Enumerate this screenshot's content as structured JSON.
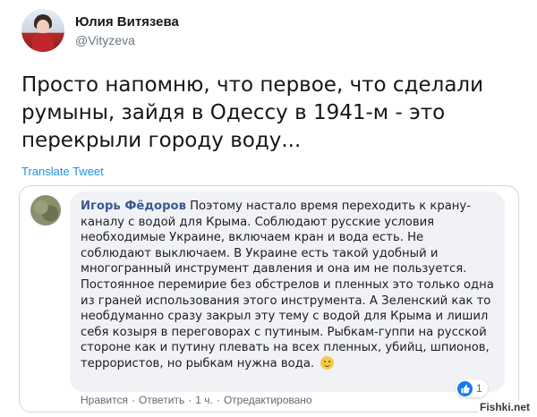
{
  "tweet": {
    "display_name": "Юлия Витязева",
    "handle": "@Vityzeva",
    "text": "Просто напомню, что первое, что сделали румыны, зайдя в Одессу в 1941-м - это перекрыли городу воду...",
    "translate_label": "Translate Tweet"
  },
  "embedded_comment": {
    "author": "Игорь Фёдоров",
    "text": "Поэтому настало время переходить к крану-каналу с водой для Крыма. Соблюдают русские условия необходимые Украине, включаем кран и вода есть. Не соблюдают выключаем. В Украине есть такой удобный и многогранный инструмент давления и она им не пользуется. Постоянное перемирие без обстрелов и пленных это только одна из граней использования этого инструмента. А Зеленский как то необдуманно сразу закрыл эту тему с водой для Крыма и лишил себя козыря в переговорах с путиным. Рыбкам-гуппи на русской стороне как и путину плевать на всех пленных, убийц, шпионов, террористов, но рыбкам нужна вода.",
    "reaction_count": "1",
    "actions": {
      "like": "Нравится",
      "reply": "Ответить",
      "time": "1 ч.",
      "edited": "Отредактировано",
      "separator": "·"
    }
  },
  "watermark": "Fishki.net",
  "icons": [
    "avatar-photo",
    "like-thumb-icon",
    "smile-emoji-icon"
  ]
}
